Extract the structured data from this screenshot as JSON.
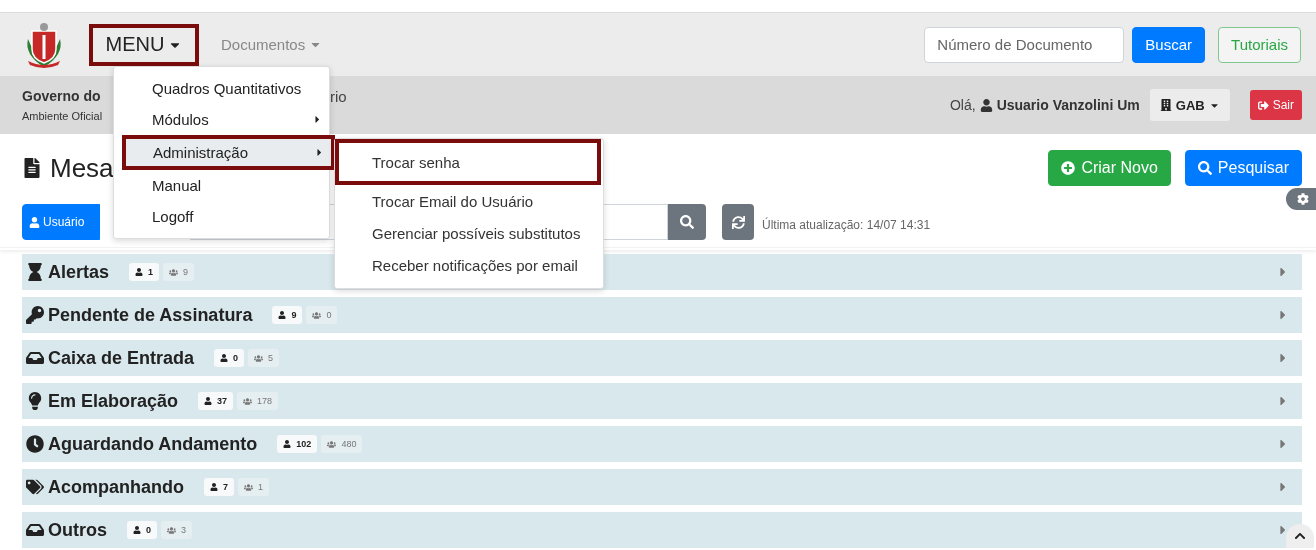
{
  "navbar": {
    "menu": {
      "label": "MENU",
      "highlighted": true
    },
    "documents": {
      "label": "Documentos"
    },
    "search": {
      "placeholder": "Número de Documento"
    },
    "search_button": "Buscar",
    "tutorials_button": "Tutoriais"
  },
  "org_bar": {
    "name_start": "Governo do",
    "name_end": "rio",
    "environment": "Ambiente Oficial",
    "greeting": "Olá,",
    "user": "Usuario Vanzolini Um",
    "unit": "GAB",
    "logout": "Sair"
  },
  "page": {
    "title": "Mesa",
    "create_button": "Criar Novo",
    "search_button": "Pesquisar"
  },
  "filters": {
    "user_toggle": {
      "label": "Usuário",
      "selected": true
    },
    "last_update": "Última atualização: 14/07 14:31"
  },
  "menu_items": [
    {
      "label": "Quadros Quantitativos",
      "has_submenu": false,
      "selected": false,
      "highlighted": false
    },
    {
      "label": "Módulos",
      "has_submenu": true,
      "selected": false,
      "highlighted": false
    },
    {
      "label": "Administração",
      "has_submenu": true,
      "selected": true,
      "highlighted": true
    },
    {
      "label": "Manual",
      "has_submenu": false,
      "selected": false,
      "highlighted": false
    },
    {
      "label": "Logoff",
      "has_submenu": false,
      "selected": false,
      "highlighted": false
    }
  ],
  "submenu_items": [
    {
      "label": "Trocar senha",
      "highlighted": true
    },
    {
      "label": "Trocar Email do Usuário",
      "highlighted": false
    },
    {
      "label": "Gerenciar possíveis substitutos",
      "highlighted": false
    },
    {
      "label": "Receber notificações por email",
      "highlighted": false
    }
  ],
  "groups": [
    {
      "title": "Alertas",
      "user_count": "1",
      "group_count": "9",
      "expanded": false
    },
    {
      "title": "Pendente de Assinatura",
      "user_count": "9",
      "group_count": "0",
      "expanded": false
    },
    {
      "title": "Caixa de Entrada",
      "user_count": "0",
      "group_count": "5",
      "expanded": false
    },
    {
      "title": "Em Elaboração",
      "user_count": "37",
      "group_count": "178",
      "expanded": false
    },
    {
      "title": "Aguardando Andamento",
      "user_count": "102",
      "group_count": "480",
      "expanded": false
    },
    {
      "title": "Acompanhando",
      "user_count": "7",
      "group_count": "1",
      "expanded": false
    },
    {
      "title": "Outros",
      "user_count": "0",
      "group_count": "3",
      "expanded": false
    }
  ]
}
